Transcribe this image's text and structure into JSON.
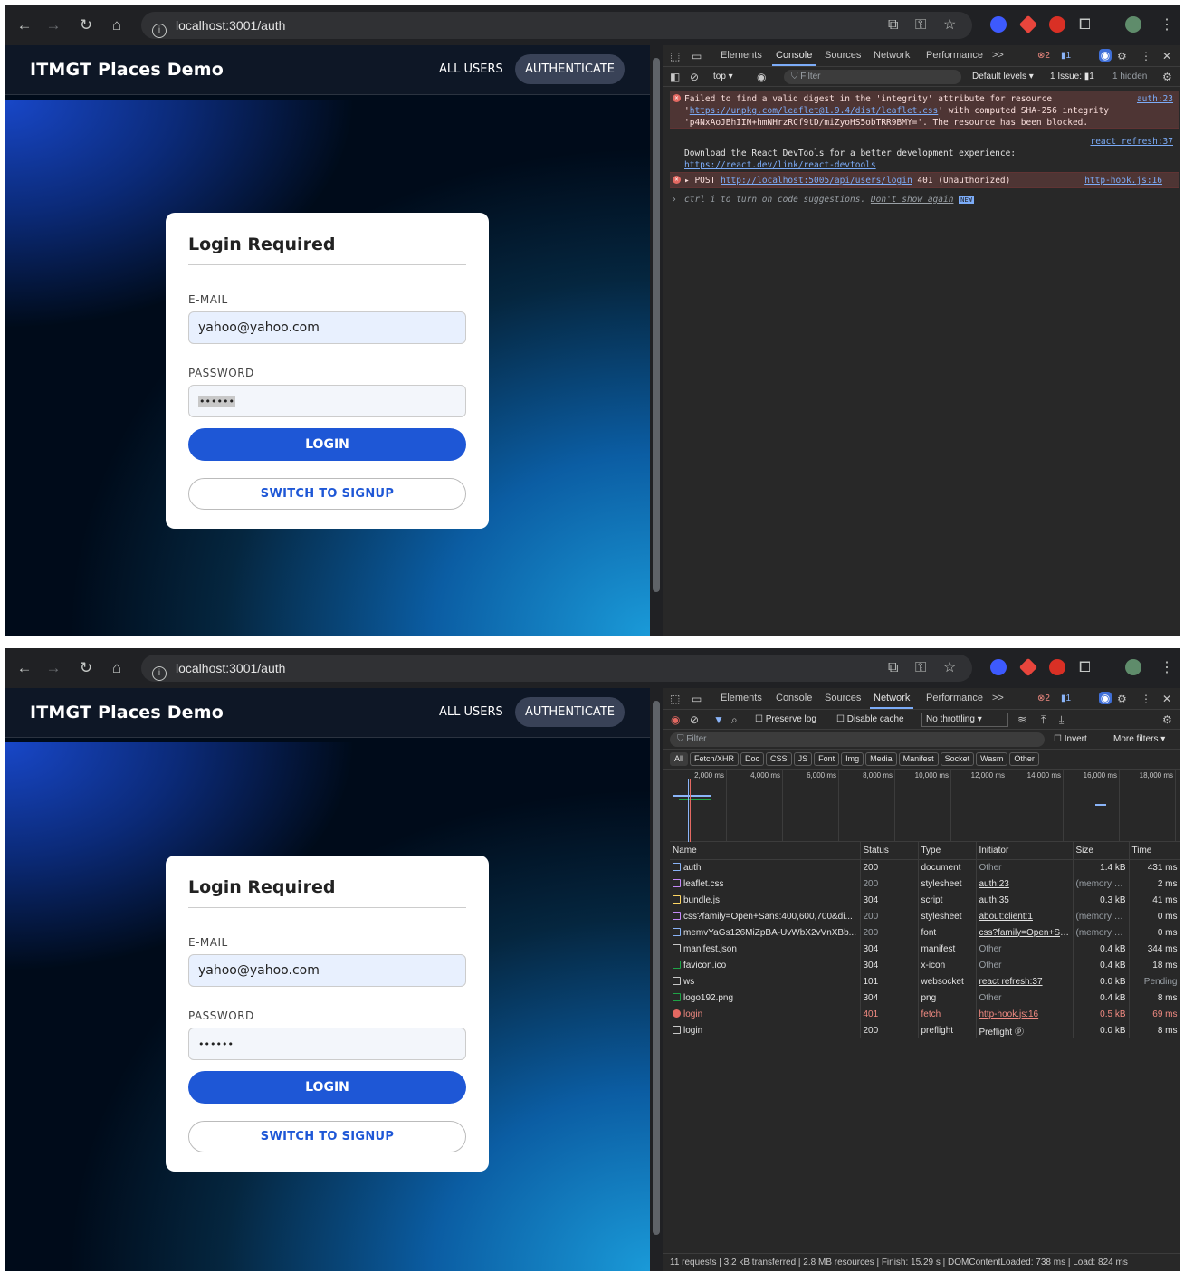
{
  "browser": {
    "url": "localhost:3001/auth"
  },
  "app": {
    "brand": "ITMGT Places Demo",
    "nav_all_users": "ALL USERS",
    "nav_authenticate": "AUTHENTICATE"
  },
  "login": {
    "title": "Login Required",
    "email_label": "E-MAIL",
    "email_value": "yahoo@yahoo.com",
    "password_label": "PASSWORD",
    "password_mask": "••••••",
    "login_button": "LOGIN",
    "switch_button": "SWITCH TO SIGNUP"
  },
  "devtools": {
    "tabs": [
      "Elements",
      "Console",
      "Sources",
      "Network",
      "Performance",
      ">>"
    ],
    "error_count": "2",
    "issue_count": "1",
    "console": {
      "context": "top ▾",
      "filter_placeholder": "Filter",
      "levels": "Default levels ▾",
      "issues": "1 Issue: ▮1",
      "hidden": "1 hidden",
      "msg1_pre": "Failed to find a valid digest in the 'integrity' attribute for resource '",
      "msg1_link": "https://unpkg.com/leaflet@1.9.4/dist/leaflet.css",
      "msg1_post": "' with computed SHA-256 integrity 'p4NxAoJBhIIN+hmNHrzRCf9tD/miZyoHS5obTRR9BMY='. The resource has been blocked.",
      "msg1_src": "auth:23",
      "msg2_src": "react refresh:37",
      "msg2_text": "Download the React DevTools for a better development experience:",
      "msg2_link": "https://react.dev/link/react-devtools",
      "msg3_method": "▸ POST",
      "msg3_link": "http://localhost:5005/api/users/login",
      "msg3_status": "401 (Unauthorized)",
      "msg3_src": "http-hook.js:16",
      "prompt_hint": "ctrl i to turn on code suggestions.",
      "prompt_dont": "Don't show again",
      "prompt_new": "NEW"
    },
    "network": {
      "preserve_log": "Preserve log",
      "disable_cache": "Disable cache",
      "throttling": "No throttling",
      "filter": "Filter",
      "invert": "Invert",
      "more_filters": "More filters ▾",
      "type_chips": [
        "All",
        "Fetch/XHR",
        "Doc",
        "CSS",
        "JS",
        "Font",
        "Img",
        "Media",
        "Manifest",
        "Socket",
        "Wasm",
        "Other"
      ],
      "timeline_ticks": [
        "2,000 ms",
        "4,000 ms",
        "6,000 ms",
        "8,000 ms",
        "10,000 ms",
        "12,000 ms",
        "14,000 ms",
        "16,000 ms",
        "18,000 ms"
      ],
      "columns": [
        "Name",
        "Status",
        "Type",
        "Initiator",
        "Size",
        "Time"
      ],
      "rows": [
        {
          "name": "auth",
          "status": "200",
          "type": "document",
          "initiator": "Other",
          "size": "1.4 kB",
          "time": "431 ms"
        },
        {
          "name": "leaflet.css",
          "status": "200",
          "type": "stylesheet",
          "initiator": "auth:23",
          "size": "(memory c...",
          "time": "2 ms"
        },
        {
          "name": "bundle.js",
          "status": "304",
          "type": "script",
          "initiator": "auth:35",
          "size": "0.3 kB",
          "time": "41 ms"
        },
        {
          "name": "css?family=Open+Sans:400,600,700&di...",
          "status": "200",
          "type": "stylesheet",
          "initiator": "about:client:1",
          "size": "(memory c...",
          "time": "0 ms"
        },
        {
          "name": "memvYaGs126MiZpBA-UvWbX2vVnXBb...",
          "status": "200",
          "type": "font",
          "initiator": "css?family=Open+Sans",
          "size": "(memory c...",
          "time": "0 ms"
        },
        {
          "name": "manifest.json",
          "status": "304",
          "type": "manifest",
          "initiator": "Other",
          "size": "0.4 kB",
          "time": "344 ms"
        },
        {
          "name": "favicon.ico",
          "status": "304",
          "type": "x-icon",
          "initiator": "Other",
          "size": "0.4 kB",
          "time": "18 ms"
        },
        {
          "name": "ws",
          "status": "101",
          "type": "websocket",
          "initiator": "react refresh:37",
          "size": "0.0 kB",
          "time": "Pending"
        },
        {
          "name": "logo192.png",
          "status": "304",
          "type": "png",
          "initiator": "Other",
          "size": "0.4 kB",
          "time": "8 ms"
        },
        {
          "name": "login",
          "status": "401",
          "type": "fetch",
          "initiator": "http-hook.js:16",
          "size": "0.5 kB",
          "time": "69 ms"
        },
        {
          "name": "login",
          "status": "200",
          "type": "preflight",
          "initiator": "Preflight ⓟ",
          "size": "0.0 kB",
          "time": "8 ms"
        }
      ],
      "summary": "11 requests | 3.2 kB transferred | 2.8 MB resources | Finish: 15.29 s | DOMContentLoaded: 738 ms | Load: 824 ms"
    }
  },
  "colors": {
    "accent": "#1e57d6",
    "error": "#f28b82",
    "devtools_bg": "#282828"
  }
}
